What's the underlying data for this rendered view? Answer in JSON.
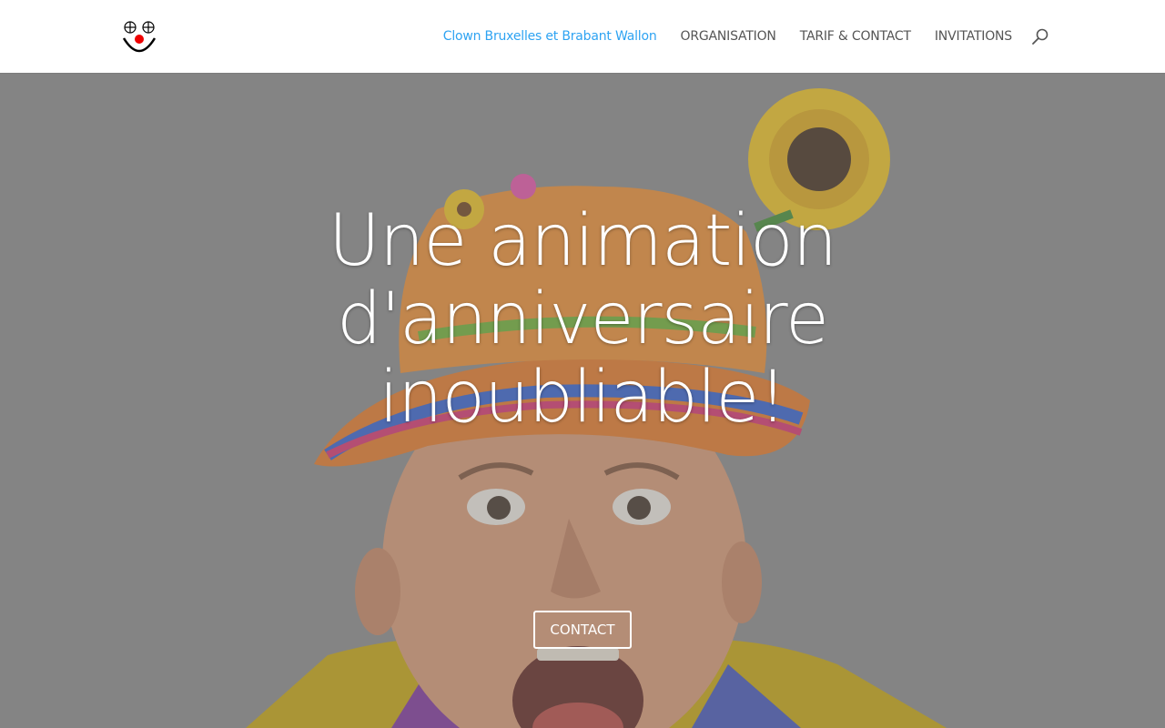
{
  "header": {
    "logo_icon": "clown-face-icon",
    "nav": [
      {
        "label": "Clown Bruxelles et Brabant Wallon",
        "active": true
      },
      {
        "label": "ORGANISATION",
        "active": false
      },
      {
        "label": "TARIF & CONTACT",
        "active": false
      },
      {
        "label": "INVITATIONS",
        "active": false
      }
    ],
    "search_icon": "search-icon"
  },
  "hero": {
    "title_line1": "Une animation",
    "title_line2": "d'anniversaire",
    "title_line3": "inoubliable!",
    "button_label": "CONTACT",
    "background": "clown-photo"
  },
  "colors": {
    "accent": "#2ea3f2",
    "nav_text": "#555555",
    "overlay": "#808080"
  }
}
